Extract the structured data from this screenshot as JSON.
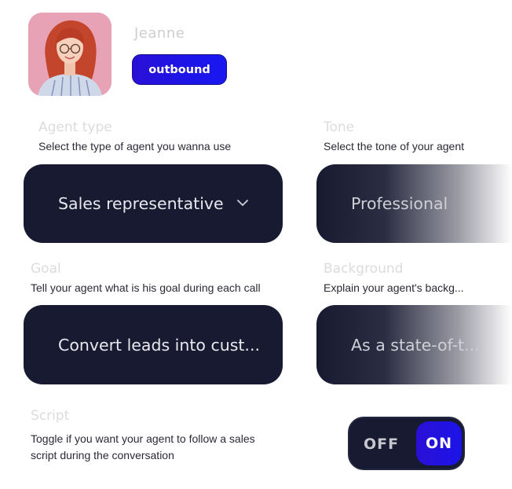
{
  "profile": {
    "name": "Jeanne",
    "badge": "outbound"
  },
  "agent_type": {
    "title": "Agent type",
    "description": "Select the type of agent you wanna use",
    "value": "Sales representative"
  },
  "tone": {
    "title": "Tone",
    "description": "Select the tone of your agent",
    "value": "Professional"
  },
  "goal": {
    "title": "Goal",
    "description": "Tell your agent what is his goal during each call",
    "value": "Convert leads into cust..."
  },
  "background": {
    "title": "Background",
    "description": "Explain your agent's backg...",
    "value": "As a state-of-t..."
  },
  "script": {
    "title": "Script",
    "description_line1": "Toggle if you want your agent to follow a sales",
    "description_line2": "script  during the conversation",
    "off_label": "OFF",
    "on_label": "ON",
    "state": "on"
  },
  "colors": {
    "field_bg": "#171a30",
    "accent": "#1d14e8",
    "avatar_bg": "#e7a0b4"
  },
  "icons": {
    "dropdown": "chevron-down-icon"
  }
}
